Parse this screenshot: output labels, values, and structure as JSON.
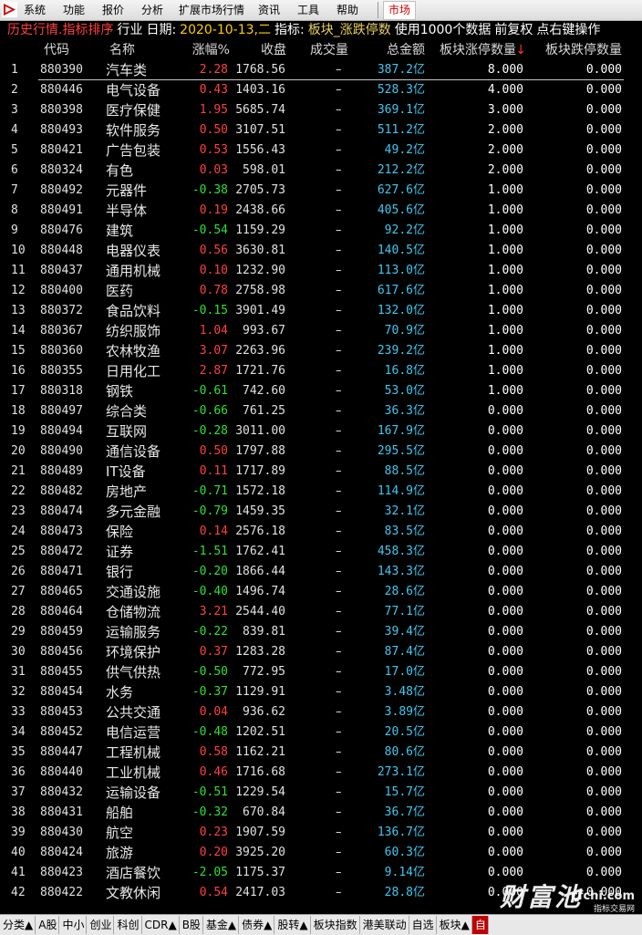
{
  "menubar": {
    "items": [
      "系统",
      "功能",
      "报价",
      "分析",
      "扩展市场行情",
      "资讯",
      "工具",
      "帮助"
    ],
    "market_button": "市场"
  },
  "titlebar": {
    "mode": "历史行情.指标排序",
    "category": "行业",
    "date_label": "日期:",
    "date_value": "2020-10-13,二",
    "indicator_label": "指标:",
    "indicator_value": "板块_涨跌停数",
    "usage_text": "使用1000个数据",
    "adjust": "前复权",
    "hint": "点右键操作"
  },
  "columns": {
    "code": "代码",
    "name": "名称",
    "change": "涨幅%",
    "close": "收盘",
    "volume": "成交量",
    "amount": "总金额",
    "limit_up": "板块涨停数量",
    "sort_arrow": "↓",
    "limit_down": "板块跌停数量"
  },
  "colors": {
    "up": "#ff4040",
    "down": "#30e030",
    "amount": "#40c8f0",
    "selected_line": "#c8c8c8"
  },
  "rows": [
    {
      "idx": "1",
      "code": "880390",
      "name": "汽车类",
      "chg": "2.28",
      "close": "1768.56",
      "vol": "–",
      "amt": "387.2",
      "up": "8.000",
      "dn": "0.000"
    },
    {
      "idx": "2",
      "code": "880446",
      "name": "电气设备",
      "chg": "0.43",
      "close": "1403.16",
      "vol": "–",
      "amt": "528.3",
      "up": "4.000",
      "dn": "0.000"
    },
    {
      "idx": "3",
      "code": "880398",
      "name": "医疗保健",
      "chg": "1.95",
      "close": "5685.74",
      "vol": "–",
      "amt": "369.1",
      "up": "3.000",
      "dn": "0.000"
    },
    {
      "idx": "4",
      "code": "880493",
      "name": "软件服务",
      "chg": "0.50",
      "close": "3107.51",
      "vol": "–",
      "amt": "511.2",
      "up": "2.000",
      "dn": "0.000"
    },
    {
      "idx": "5",
      "code": "880421",
      "name": "广告包装",
      "chg": "0.53",
      "close": "1556.43",
      "vol": "–",
      "amt": "49.2",
      "up": "2.000",
      "dn": "0.000"
    },
    {
      "idx": "6",
      "code": "880324",
      "name": "有色",
      "chg": "0.03",
      "close": "598.01",
      "vol": "–",
      "amt": "212.2",
      "up": "2.000",
      "dn": "0.000"
    },
    {
      "idx": "7",
      "code": "880492",
      "name": "元器件",
      "chg": "-0.38",
      "close": "2705.73",
      "vol": "–",
      "amt": "627.6",
      "up": "1.000",
      "dn": "0.000"
    },
    {
      "idx": "8",
      "code": "880491",
      "name": "半导体",
      "chg": "0.19",
      "close": "2438.66",
      "vol": "–",
      "amt": "405.6",
      "up": "1.000",
      "dn": "0.000"
    },
    {
      "idx": "9",
      "code": "880476",
      "name": "建筑",
      "chg": "-0.54",
      "close": "1159.29",
      "vol": "–",
      "amt": "92.2",
      "up": "1.000",
      "dn": "0.000"
    },
    {
      "idx": "10",
      "code": "880448",
      "name": "电器仪表",
      "chg": "0.56",
      "close": "3630.81",
      "vol": "–",
      "amt": "140.5",
      "up": "1.000",
      "dn": "0.000"
    },
    {
      "idx": "11",
      "code": "880437",
      "name": "通用机械",
      "chg": "0.10",
      "close": "1232.90",
      "vol": "–",
      "amt": "113.0",
      "up": "1.000",
      "dn": "0.000"
    },
    {
      "idx": "12",
      "code": "880400",
      "name": "医药",
      "chg": "0.78",
      "close": "2758.98",
      "vol": "–",
      "amt": "617.6",
      "up": "1.000",
      "dn": "0.000"
    },
    {
      "idx": "13",
      "code": "880372",
      "name": "食品饮料",
      "chg": "-0.15",
      "close": "3901.49",
      "vol": "–",
      "amt": "132.0",
      "up": "1.000",
      "dn": "0.000"
    },
    {
      "idx": "14",
      "code": "880367",
      "name": "纺织服饰",
      "chg": "1.04",
      "close": "993.67",
      "vol": "–",
      "amt": "70.9",
      "up": "1.000",
      "dn": "0.000"
    },
    {
      "idx": "15",
      "code": "880360",
      "name": "农林牧渔",
      "chg": "3.07",
      "close": "2263.96",
      "vol": "–",
      "amt": "239.2",
      "up": "1.000",
      "dn": "0.000"
    },
    {
      "idx": "16",
      "code": "880355",
      "name": "日用化工",
      "chg": "2.87",
      "close": "1721.76",
      "vol": "–",
      "amt": "16.8",
      "up": "1.000",
      "dn": "0.000"
    },
    {
      "idx": "17",
      "code": "880318",
      "name": "钢铁",
      "chg": "-0.61",
      "close": "742.60",
      "vol": "–",
      "amt": "53.0",
      "up": "1.000",
      "dn": "0.000"
    },
    {
      "idx": "18",
      "code": "880497",
      "name": "综合类",
      "chg": "-0.66",
      "close": "761.25",
      "vol": "–",
      "amt": "36.3",
      "up": "0.000",
      "dn": "0.000"
    },
    {
      "idx": "19",
      "code": "880494",
      "name": "互联网",
      "chg": "-0.28",
      "close": "3011.00",
      "vol": "–",
      "amt": "167.9",
      "up": "0.000",
      "dn": "0.000"
    },
    {
      "idx": "20",
      "code": "880490",
      "name": "通信设备",
      "chg": "0.50",
      "close": "1797.88",
      "vol": "–",
      "amt": "295.5",
      "up": "0.000",
      "dn": "0.000"
    },
    {
      "idx": "21",
      "code": "880489",
      "name": "IT设备",
      "chg": "0.11",
      "close": "1717.89",
      "vol": "–",
      "amt": "88.5",
      "up": "0.000",
      "dn": "0.000"
    },
    {
      "idx": "22",
      "code": "880482",
      "name": "房地产",
      "chg": "-0.71",
      "close": "1572.18",
      "vol": "–",
      "amt": "114.9",
      "up": "0.000",
      "dn": "0.000"
    },
    {
      "idx": "23",
      "code": "880474",
      "name": "多元金融",
      "chg": "-0.79",
      "close": "1459.35",
      "vol": "–",
      "amt": "32.1",
      "up": "0.000",
      "dn": "0.000"
    },
    {
      "idx": "24",
      "code": "880473",
      "name": "保险",
      "chg": "0.14",
      "close": "2576.18",
      "vol": "–",
      "amt": "83.5",
      "up": "0.000",
      "dn": "0.000"
    },
    {
      "idx": "25",
      "code": "880472",
      "name": "证券",
      "chg": "-1.51",
      "close": "1762.41",
      "vol": "–",
      "amt": "458.3",
      "up": "0.000",
      "dn": "0.000"
    },
    {
      "idx": "26",
      "code": "880471",
      "name": "银行",
      "chg": "-0.20",
      "close": "1866.44",
      "vol": "–",
      "amt": "143.3",
      "up": "0.000",
      "dn": "0.000"
    },
    {
      "idx": "27",
      "code": "880465",
      "name": "交通设施",
      "chg": "-0.40",
      "close": "1496.74",
      "vol": "–",
      "amt": "28.6",
      "up": "0.000",
      "dn": "0.000"
    },
    {
      "idx": "28",
      "code": "880464",
      "name": "仓储物流",
      "chg": "3.21",
      "close": "2544.40",
      "vol": "–",
      "amt": "77.1",
      "up": "0.000",
      "dn": "0.000"
    },
    {
      "idx": "29",
      "code": "880459",
      "name": "运输服务",
      "chg": "-0.22",
      "close": "839.81",
      "vol": "–",
      "amt": "39.4",
      "up": "0.000",
      "dn": "0.000"
    },
    {
      "idx": "30",
      "code": "880456",
      "name": "环境保护",
      "chg": "0.37",
      "close": "1283.28",
      "vol": "–",
      "amt": "87.4",
      "up": "0.000",
      "dn": "0.000"
    },
    {
      "idx": "31",
      "code": "880455",
      "name": "供气供热",
      "chg": "-0.50",
      "close": "772.95",
      "vol": "–",
      "amt": "17.0",
      "up": "0.000",
      "dn": "0.000"
    },
    {
      "idx": "32",
      "code": "880454",
      "name": "水务",
      "chg": "-0.37",
      "close": "1129.91",
      "vol": "–",
      "amt": "3.48",
      "up": "0.000",
      "dn": "0.000"
    },
    {
      "idx": "33",
      "code": "880453",
      "name": "公共交通",
      "chg": "0.04",
      "close": "936.62",
      "vol": "–",
      "amt": "3.89",
      "up": "0.000",
      "dn": "0.000"
    },
    {
      "idx": "34",
      "code": "880452",
      "name": "电信运营",
      "chg": "-0.48",
      "close": "1202.51",
      "vol": "–",
      "amt": "20.5",
      "up": "0.000",
      "dn": "0.000"
    },
    {
      "idx": "35",
      "code": "880447",
      "name": "工程机械",
      "chg": "0.58",
      "close": "1162.21",
      "vol": "–",
      "amt": "80.6",
      "up": "0.000",
      "dn": "0.000"
    },
    {
      "idx": "36",
      "code": "880440",
      "name": "工业机械",
      "chg": "0.46",
      "close": "1716.68",
      "vol": "–",
      "amt": "273.1",
      "up": "0.000",
      "dn": "0.000"
    },
    {
      "idx": "37",
      "code": "880432",
      "name": "运输设备",
      "chg": "-0.51",
      "close": "1229.54",
      "vol": "–",
      "amt": "15.7",
      "up": "0.000",
      "dn": "0.000"
    },
    {
      "idx": "38",
      "code": "880431",
      "name": "船舶",
      "chg": "-0.32",
      "close": "670.84",
      "vol": "–",
      "amt": "36.7",
      "up": "0.000",
      "dn": "0.000"
    },
    {
      "idx": "39",
      "code": "880430",
      "name": "航空",
      "chg": "0.23",
      "close": "1907.59",
      "vol": "–",
      "amt": "136.7",
      "up": "0.000",
      "dn": "0.000"
    },
    {
      "idx": "40",
      "code": "880424",
      "name": "旅游",
      "chg": "0.20",
      "close": "3925.20",
      "vol": "–",
      "amt": "60.3",
      "up": "0.000",
      "dn": "0.000"
    },
    {
      "idx": "41",
      "code": "880423",
      "name": "酒店餐饮",
      "chg": "-2.05",
      "close": "1175.37",
      "vol": "–",
      "amt": "9.14",
      "up": "0.000",
      "dn": "0.000"
    },
    {
      "idx": "42",
      "code": "880422",
      "name": "文教休闲",
      "chg": "0.54",
      "close": "2417.03",
      "vol": "–",
      "amt": "28.8",
      "up": "0.000",
      "dn": "0.000"
    }
  ],
  "amount_unit": "亿",
  "tabs": [
    "分类▲",
    "A股",
    "中小",
    "创业",
    "科创",
    "CDR▲",
    "B股",
    "基金▲",
    "债券▲",
    "股转▲",
    "板块指数",
    "港美联动",
    "自选",
    "板块▲",
    "自"
  ],
  "watermark": {
    "big": "财富池",
    "site": "cfchi.com",
    "sub": "指标交易网"
  }
}
